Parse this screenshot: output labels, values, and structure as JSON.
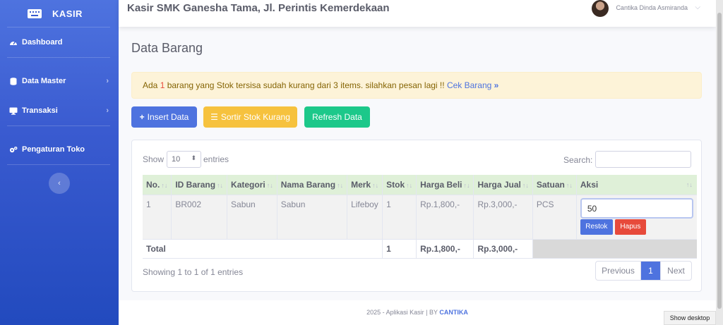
{
  "sidebar": {
    "brand": "KASIR",
    "items": [
      {
        "label": "Dashboard"
      },
      {
        "label": "Data Master"
      },
      {
        "label": "Transaksi"
      },
      {
        "label": "Pengaturan Toko"
      }
    ],
    "toggle_glyph": "‹"
  },
  "topbar": {
    "title": "Kasir SMK Ganesha Tama, Jl. Perintis Kemerdekaan",
    "user_name": "Cantika Dinda Asmiranda"
  },
  "page": {
    "title": "Data Barang"
  },
  "alert": {
    "prefix": "Ada ",
    "count": "1",
    "message": " barang yang Stok tersisa sudah kurang dari 3 items. silahkan pesan lagi !! ",
    "link": "Cek Barang"
  },
  "buttons": {
    "insert": "Insert Data",
    "sort": "Sortir Stok Kurang",
    "refresh": "Refresh Data"
  },
  "table": {
    "show_label": "Show",
    "page_size": "10",
    "entries_label": "entries",
    "search_label": "Search:",
    "columns": [
      "No.",
      "ID Barang",
      "Kategori",
      "Nama Barang",
      "Merk",
      "Stok",
      "Harga Beli",
      "Harga Jual",
      "Satuan",
      "Aksi"
    ],
    "rows": [
      {
        "no": "1",
        "id": "BR002",
        "kategori": "Sabun",
        "nama": "Sabun",
        "merk": "Lifeboy",
        "stok": "1",
        "harga_beli": "Rp.1,800,-",
        "harga_jual": "Rp.3,000,-",
        "satuan": "PCS",
        "qty_value": "50",
        "restok_label": "Restok",
        "hapus_label": "Hapus"
      }
    ],
    "total": {
      "label": "Total",
      "stok": "1",
      "harga_beli": "Rp.1,800,-",
      "harga_jual": "Rp.3,000,-"
    },
    "showing": "Showing 1 to 1 of 1 entries",
    "pagination": {
      "previous": "Previous",
      "current": "1",
      "next": "Next"
    }
  },
  "footer": {
    "text": "2025 - Aplikasi Kasir | BY ",
    "brand": "CANTIKA"
  },
  "taskbar": {
    "show_desktop": "Show desktop"
  },
  "colors": {
    "primary": "#4e73df",
    "warning": "#f6c23e",
    "success": "#1cc88a",
    "danger": "#e74a3b",
    "table_header": "#dff0d8"
  }
}
